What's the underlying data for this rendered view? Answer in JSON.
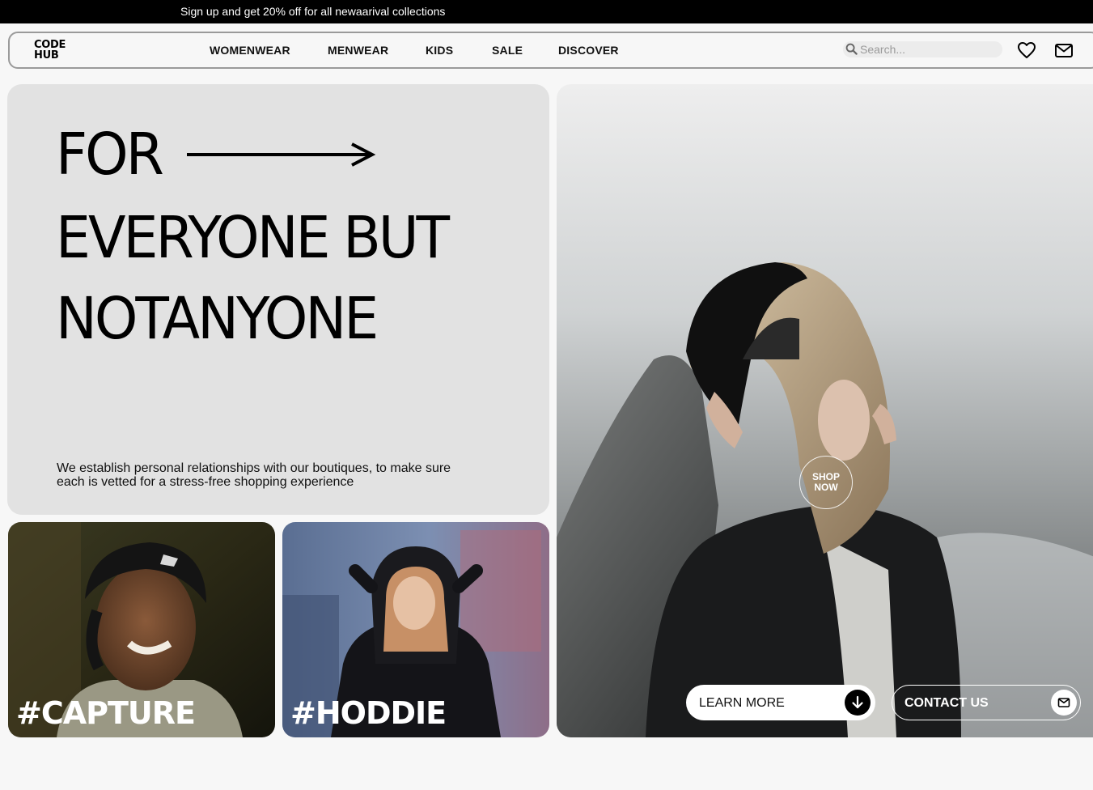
{
  "announcement": "Sign up and get 20% off for all newaarival collections",
  "logo": {
    "line1": "CODE",
    "line2": "HUB"
  },
  "nav": [
    "WOMENWEAR",
    "MENWEAR",
    "KIDS",
    "SALE",
    "DISCOVER"
  ],
  "search": {
    "placeholder": "Search..."
  },
  "icons": {
    "search": "search-icon",
    "wishlist": "heart-icon",
    "mail": "mail-icon"
  },
  "hero": {
    "line1": "FOR",
    "line2": "EVERYONE BUT",
    "line3": "NOTANYONE",
    "description": "We establish personal relationships with our boutiques, to make sure each is vetted for a stress-free shopping experience"
  },
  "cards": [
    {
      "tag": "#CAPTURE"
    },
    {
      "tag": "#HODDIE"
    }
  ],
  "feature": {
    "shop_now": "SHOP NOW",
    "learn_more": "LEARN MORE",
    "contact_us": "CONTACT US"
  }
}
